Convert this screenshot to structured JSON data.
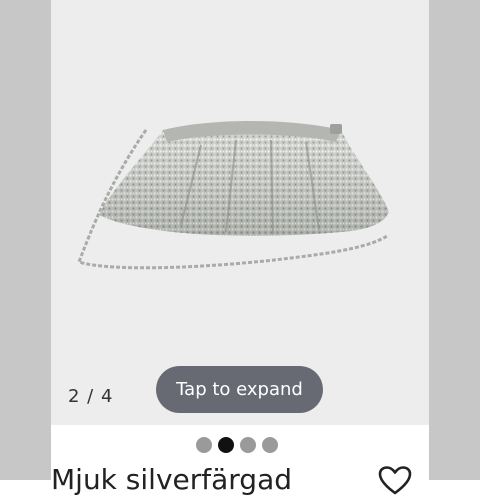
{
  "gallery": {
    "counter": "2 / 4",
    "expand_label": "Tap to expand",
    "dots": [
      {
        "active": false
      },
      {
        "active": true
      },
      {
        "active": false
      },
      {
        "active": false
      }
    ]
  },
  "product": {
    "name": "Mjuk silverfärgad"
  },
  "icons": {
    "favorite": "heart-outline-icon"
  },
  "colors": {
    "image_background": "#ededed",
    "side_gray": "#c7c7c7",
    "button_background": "#676a72",
    "dot_active": "#111111",
    "dot_inactive": "#9a9a9a"
  }
}
